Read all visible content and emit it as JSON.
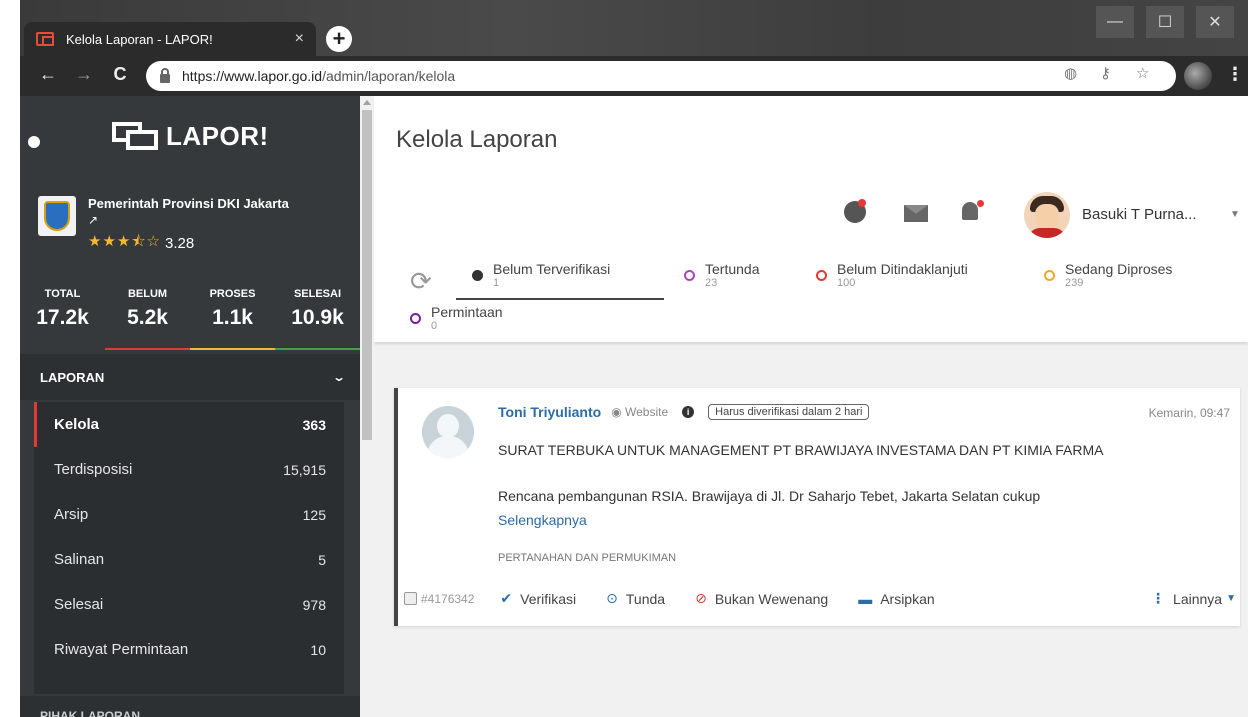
{
  "browser": {
    "tab_title": "Kelola Laporan - LAPOR!",
    "tab_close": "×",
    "new_tab": "+",
    "url_host": "https://www.lapor.go.id",
    "url_path": "/admin/laporan/kelola",
    "icons": [
      "back-icon",
      "forward-icon",
      "reload-icon",
      "lock-icon",
      "translate-icon",
      "key-icon",
      "star-icon",
      "profile-icon",
      "menu-icon"
    ]
  },
  "sidebar": {
    "logo_text": "LAPOR!",
    "agency_name": "Pemerintah Provinsi DKI Jakarta",
    "rating": "3.28",
    "rating_stars": 3.5,
    "stats": [
      {
        "label": "TOTAL",
        "value": "17.2k"
      },
      {
        "label": "BELUM",
        "value": "5.2k"
      },
      {
        "label": "PROSES",
        "value": "1.1k"
      },
      {
        "label": "SELESAI",
        "value": "10.9k"
      }
    ],
    "stat_colors": [
      "#35393c",
      "#e53935",
      "#f5b82e",
      "#43a047"
    ],
    "section_title": "LAPORAN",
    "menu": [
      {
        "label": "Kelola",
        "count": "363",
        "active": true
      },
      {
        "label": "Terdisposisi",
        "count": "15,915"
      },
      {
        "label": "Arsip",
        "count": "125"
      },
      {
        "label": "Salinan",
        "count": "5"
      },
      {
        "label": "Selesai",
        "count": "978"
      },
      {
        "label": "Riwayat Permintaan",
        "count": "10"
      }
    ],
    "section2_title": "PIHAK LAPORAN"
  },
  "header": {
    "page_title": "Kelola Laporan",
    "user_name": "Basuki T Purna...",
    "icons": [
      "info-icon",
      "mail-icon",
      "bell-icon"
    ]
  },
  "status_tabs": [
    {
      "label": "Belum Terverifikasi",
      "count": "1",
      "color": "#333333",
      "active": true
    },
    {
      "label": "Tertunda",
      "count": "23",
      "color": "#ab47bc"
    },
    {
      "label": "Belum Ditindaklanjuti",
      "count": "100",
      "color": "#e53935"
    },
    {
      "label": "Sedang Diproses",
      "count": "239",
      "color": "#f5a623"
    },
    {
      "label": "Permintaan",
      "count": "0",
      "color": "#7b1fa2"
    }
  ],
  "report": {
    "author": "Toni Triyulianto",
    "source": "Website",
    "deadline": "Harus diverifikasi dalam 2 hari",
    "time": "Kemarin, 09:47",
    "title": "SURAT TERBUKA UNTUK MANAGEMENT PT BRAWIJAYA INVESTAMA DAN PT KIMIA FARMA",
    "excerpt": "Rencana pembangunan RSIA. Brawijaya di Jl. Dr Saharjo Tebet, Jakarta Selatan cukup",
    "more_link": "Selengkapnya",
    "category": "PERTANAHAN DAN PERMUKIMAN",
    "ticket": "#4176342",
    "actions": {
      "verify": "Verifikasi",
      "hold": "Tunda",
      "reject": "Bukan Wewenang",
      "archive": "Arsipkan",
      "more": "Lainnya"
    }
  }
}
